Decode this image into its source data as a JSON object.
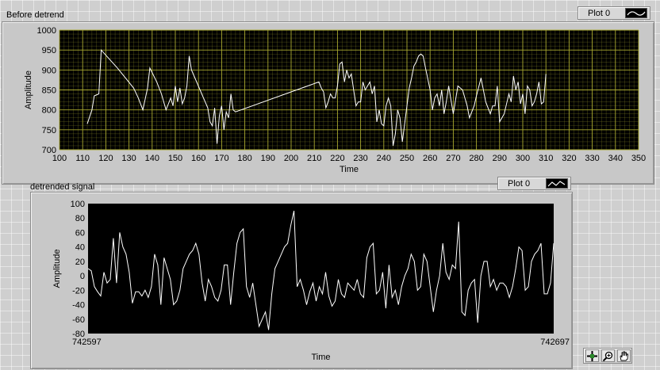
{
  "charts": {
    "before": {
      "label": "Before detrend",
      "legend": "Plot 0",
      "xlabel": "Time",
      "ylabel": "Amplitude"
    },
    "detrended": {
      "label": "detrended signal",
      "legend": "Plot 0",
      "xlabel": "Time",
      "ylabel": "Amplitude"
    }
  },
  "palette": {
    "tools": [
      "cursor-move",
      "zoom",
      "pan"
    ]
  },
  "colors": {
    "plot_bg_before": "#000000",
    "grid_before": "#a8a830",
    "plot_bg_detrended": "#000000",
    "trace": "#ffffff"
  },
  "chart_data": [
    {
      "type": "line",
      "title": "Before detrend",
      "xlabel": "Time",
      "ylabel": "Amplitude",
      "xlim": [
        100,
        350
      ],
      "ylim": [
        700,
        1000
      ],
      "xticks": [
        100,
        110,
        120,
        130,
        140,
        150,
        160,
        170,
        180,
        190,
        200,
        210,
        220,
        230,
        240,
        250,
        260,
        270,
        280,
        290,
        300,
        310,
        320,
        330,
        340,
        350
      ],
      "yticks": [
        700,
        750,
        800,
        850,
        900,
        950,
        1000
      ],
      "grid": true,
      "legend": "top-right",
      "series": [
        {
          "name": "Plot 0",
          "x": [
            112,
            114,
            115,
            117,
            118,
            125,
            132,
            134,
            136,
            138,
            139,
            142,
            144,
            146,
            148,
            149,
            150,
            151,
            152,
            153,
            154,
            155,
            156,
            157,
            164,
            165,
            166,
            167,
            168,
            169,
            170,
            171,
            172,
            173,
            174,
            175,
            176,
            212,
            213,
            214,
            215,
            216,
            217,
            218,
            219,
            220,
            221,
            222,
            223,
            224,
            225,
            226,
            227,
            228,
            229,
            230,
            231,
            232,
            234,
            235,
            236,
            237,
            238,
            239,
            240,
            241,
            242,
            243,
            244,
            245,
            246,
            247,
            248,
            250,
            251,
            252,
            253,
            254,
            255,
            256,
            257,
            258,
            260,
            261,
            262,
            263,
            264,
            265,
            266,
            267,
            268,
            270,
            272,
            274,
            276,
            277,
            279,
            280,
            282,
            284,
            286,
            287,
            288,
            289,
            290,
            292,
            294,
            295,
            296,
            297,
            298,
            299,
            300,
            301,
            302,
            303,
            304,
            305,
            306,
            307,
            308,
            309,
            310
          ],
          "y": [
            765,
            800,
            835,
            840,
            950,
            905,
            855,
            830,
            800,
            855,
            905,
            870,
            840,
            800,
            830,
            810,
            860,
            820,
            855,
            815,
            830,
            860,
            935,
            900,
            805,
            770,
            760,
            805,
            715,
            785,
            810,
            750,
            795,
            780,
            840,
            800,
            795,
            870,
            855,
            845,
            805,
            820,
            840,
            830,
            830,
            860,
            915,
            920,
            870,
            900,
            880,
            890,
            850,
            810,
            820,
            820,
            870,
            850,
            870,
            840,
            860,
            770,
            800,
            765,
            760,
            810,
            830,
            810,
            710,
            740,
            800,
            780,
            720,
            810,
            855,
            880,
            910,
            920,
            935,
            940,
            935,
            905,
            850,
            800,
            830,
            840,
            810,
            850,
            790,
            820,
            860,
            790,
            860,
            850,
            810,
            780,
            810,
            835,
            880,
            820,
            790,
            810,
            810,
            860,
            770,
            790,
            840,
            820,
            885,
            850,
            870,
            815,
            840,
            790,
            860,
            850,
            810,
            820,
            840,
            870,
            815,
            820,
            890
          ]
        }
      ]
    },
    {
      "type": "line",
      "title": "detrended signal",
      "xlabel": "Time",
      "ylabel": "Amplitude",
      "xlim": [
        742597,
        742697
      ],
      "ylim": [
        -80,
        100
      ],
      "xticks": [
        742597,
        742697
      ],
      "yticks": [
        -80,
        -60,
        -40,
        -20,
        0,
        20,
        40,
        60,
        80,
        100
      ],
      "grid": false,
      "legend": "top-right",
      "series": [
        {
          "name": "Plot 0",
          "y": [
            10,
            7,
            -15,
            -22,
            -28,
            5,
            -10,
            -5,
            52,
            -10,
            60,
            40,
            30,
            5,
            -38,
            -22,
            -22,
            -28,
            -20,
            -30,
            -15,
            30,
            15,
            -40,
            25,
            10,
            -5,
            -40,
            -35,
            -20,
            10,
            20,
            30,
            35,
            45,
            30,
            -10,
            -35,
            -5,
            -15,
            -30,
            -35,
            -20,
            15,
            15,
            -40,
            5,
            45,
            60,
            65,
            -15,
            -30,
            -10,
            -40,
            -70,
            -60,
            -50,
            -75,
            -25,
            10,
            20,
            30,
            40,
            45,
            70,
            90,
            -15,
            -5,
            -20,
            -40,
            -22,
            -10,
            -35,
            -15,
            -25,
            5,
            -28,
            -42,
            -35,
            -5,
            -25,
            -30,
            -10,
            -15,
            -20,
            -5,
            -25,
            -30,
            25,
            40,
            45,
            -25,
            -20,
            5,
            -45,
            15,
            -30,
            -20,
            -40,
            -15,
            0,
            10,
            30,
            20,
            -20,
            -15,
            30,
            20,
            -15,
            -50,
            -20,
            0,
            45,
            5,
            -5,
            15,
            10,
            75,
            -50,
            -55,
            -20,
            -10,
            -5,
            -65,
            0,
            20,
            20,
            -15,
            -5,
            -20,
            -10,
            -10,
            -15,
            -30,
            -15,
            10,
            40,
            35,
            -20,
            -15,
            20,
            30,
            35,
            45,
            -25,
            -25,
            -10,
            45
          ]
        }
      ]
    }
  ]
}
